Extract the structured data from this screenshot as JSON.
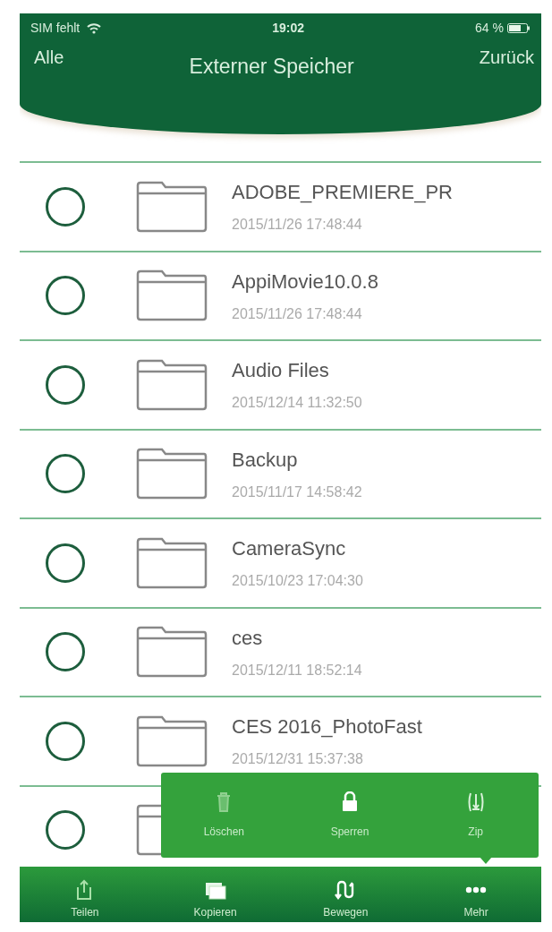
{
  "status_bar": {
    "carrier": "SIM fehlt",
    "time": "19:02",
    "battery": "64 %"
  },
  "nav": {
    "left": "Alle",
    "title": "Externer Speicher",
    "right": "Zurück"
  },
  "files": [
    {
      "name": "ADOBE_PREMIERE_PR",
      "date": "2015/11/26 17:48:44",
      "selected": false
    },
    {
      "name": "AppiMovie10.0.8",
      "date": "2015/11/26 17:48:44",
      "selected": false
    },
    {
      "name": "Audio Files",
      "date": "2015/12/14 11:32:50",
      "selected": false
    },
    {
      "name": "Backup",
      "date": "2015/11/17 14:58:42",
      "selected": false
    },
    {
      "name": "CameraSync",
      "date": "2015/10/23 17:04:30",
      "selected": false
    },
    {
      "name": "ces",
      "date": "2015/12/11 18:52:14",
      "selected": false
    },
    {
      "name": "CES 2016_PhotoFast",
      "date": "2015/12/31 15:37:38",
      "selected": false
    },
    {
      "selected": false
    }
  ],
  "popup_menu": [
    {
      "kind": "trash",
      "label": "Löschen"
    },
    {
      "kind": "lock",
      "label": "Sperren"
    },
    {
      "kind": "zip",
      "label": "Zip"
    }
  ],
  "toolbar": [
    {
      "kind": "share",
      "label": "Teilen"
    },
    {
      "kind": "copy",
      "label": "Kopieren"
    },
    {
      "kind": "move",
      "label": "Bewegen"
    },
    {
      "kind": "more",
      "label": "Mehr"
    }
  ]
}
